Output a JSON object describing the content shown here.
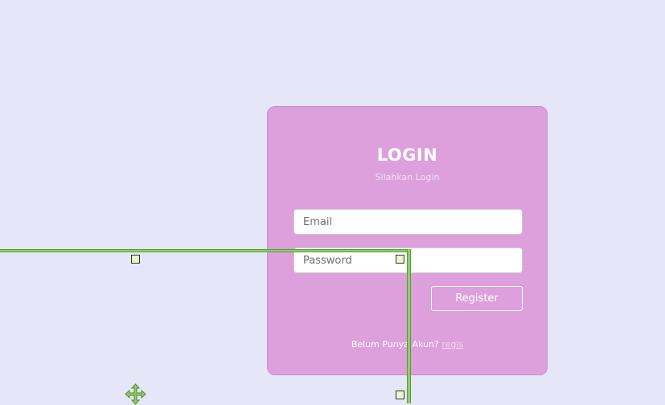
{
  "login": {
    "title": "LOGIN",
    "subtitle": "Silahkan Login",
    "email_placeholder": "Email",
    "password_placeholder": "Password",
    "register_label": "Register",
    "footer_text": "Belum Punya Akun? ",
    "footer_link": "regis"
  },
  "colors": {
    "background": "#e6e6f9",
    "card": "#dda0dd",
    "guide": "#8cd164"
  },
  "overlay": {
    "icon": "move-icon",
    "handle_icon": "resize-handle"
  }
}
